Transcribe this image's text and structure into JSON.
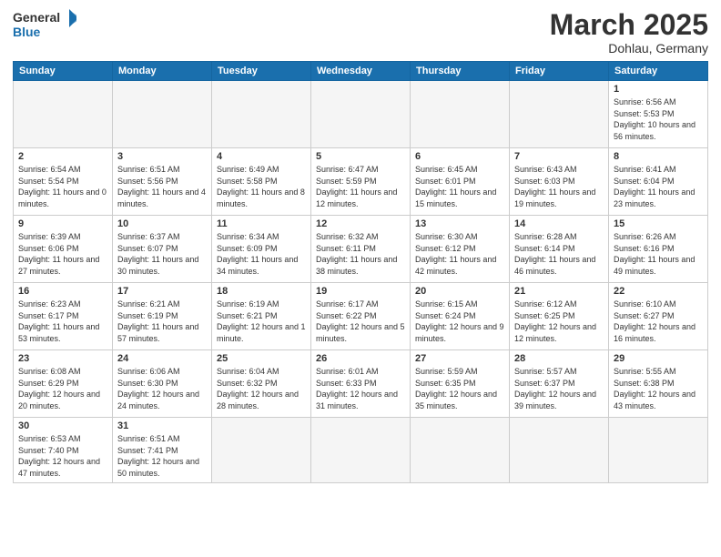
{
  "header": {
    "logo_general": "General",
    "logo_blue": "Blue",
    "month": "March 2025",
    "location": "Dohlau, Germany"
  },
  "days_of_week": [
    "Sunday",
    "Monday",
    "Tuesday",
    "Wednesday",
    "Thursday",
    "Friday",
    "Saturday"
  ],
  "weeks": [
    [
      {
        "num": "",
        "info": ""
      },
      {
        "num": "",
        "info": ""
      },
      {
        "num": "",
        "info": ""
      },
      {
        "num": "",
        "info": ""
      },
      {
        "num": "",
        "info": ""
      },
      {
        "num": "",
        "info": ""
      },
      {
        "num": "1",
        "info": "Sunrise: 6:56 AM\nSunset: 5:53 PM\nDaylight: 10 hours and 56 minutes."
      }
    ],
    [
      {
        "num": "2",
        "info": "Sunrise: 6:54 AM\nSunset: 5:54 PM\nDaylight: 11 hours and 0 minutes."
      },
      {
        "num": "3",
        "info": "Sunrise: 6:51 AM\nSunset: 5:56 PM\nDaylight: 11 hours and 4 minutes."
      },
      {
        "num": "4",
        "info": "Sunrise: 6:49 AM\nSunset: 5:58 PM\nDaylight: 11 hours and 8 minutes."
      },
      {
        "num": "5",
        "info": "Sunrise: 6:47 AM\nSunset: 5:59 PM\nDaylight: 11 hours and 12 minutes."
      },
      {
        "num": "6",
        "info": "Sunrise: 6:45 AM\nSunset: 6:01 PM\nDaylight: 11 hours and 15 minutes."
      },
      {
        "num": "7",
        "info": "Sunrise: 6:43 AM\nSunset: 6:03 PM\nDaylight: 11 hours and 19 minutes."
      },
      {
        "num": "8",
        "info": "Sunrise: 6:41 AM\nSunset: 6:04 PM\nDaylight: 11 hours and 23 minutes."
      }
    ],
    [
      {
        "num": "9",
        "info": "Sunrise: 6:39 AM\nSunset: 6:06 PM\nDaylight: 11 hours and 27 minutes."
      },
      {
        "num": "10",
        "info": "Sunrise: 6:37 AM\nSunset: 6:07 PM\nDaylight: 11 hours and 30 minutes."
      },
      {
        "num": "11",
        "info": "Sunrise: 6:34 AM\nSunset: 6:09 PM\nDaylight: 11 hours and 34 minutes."
      },
      {
        "num": "12",
        "info": "Sunrise: 6:32 AM\nSunset: 6:11 PM\nDaylight: 11 hours and 38 minutes."
      },
      {
        "num": "13",
        "info": "Sunrise: 6:30 AM\nSunset: 6:12 PM\nDaylight: 11 hours and 42 minutes."
      },
      {
        "num": "14",
        "info": "Sunrise: 6:28 AM\nSunset: 6:14 PM\nDaylight: 11 hours and 46 minutes."
      },
      {
        "num": "15",
        "info": "Sunrise: 6:26 AM\nSunset: 6:16 PM\nDaylight: 11 hours and 49 minutes."
      }
    ],
    [
      {
        "num": "16",
        "info": "Sunrise: 6:23 AM\nSunset: 6:17 PM\nDaylight: 11 hours and 53 minutes."
      },
      {
        "num": "17",
        "info": "Sunrise: 6:21 AM\nSunset: 6:19 PM\nDaylight: 11 hours and 57 minutes."
      },
      {
        "num": "18",
        "info": "Sunrise: 6:19 AM\nSunset: 6:21 PM\nDaylight: 12 hours and 1 minute."
      },
      {
        "num": "19",
        "info": "Sunrise: 6:17 AM\nSunset: 6:22 PM\nDaylight: 12 hours and 5 minutes."
      },
      {
        "num": "20",
        "info": "Sunrise: 6:15 AM\nSunset: 6:24 PM\nDaylight: 12 hours and 9 minutes."
      },
      {
        "num": "21",
        "info": "Sunrise: 6:12 AM\nSunset: 6:25 PM\nDaylight: 12 hours and 12 minutes."
      },
      {
        "num": "22",
        "info": "Sunrise: 6:10 AM\nSunset: 6:27 PM\nDaylight: 12 hours and 16 minutes."
      }
    ],
    [
      {
        "num": "23",
        "info": "Sunrise: 6:08 AM\nSunset: 6:29 PM\nDaylight: 12 hours and 20 minutes."
      },
      {
        "num": "24",
        "info": "Sunrise: 6:06 AM\nSunset: 6:30 PM\nDaylight: 12 hours and 24 minutes."
      },
      {
        "num": "25",
        "info": "Sunrise: 6:04 AM\nSunset: 6:32 PM\nDaylight: 12 hours and 28 minutes."
      },
      {
        "num": "26",
        "info": "Sunrise: 6:01 AM\nSunset: 6:33 PM\nDaylight: 12 hours and 31 minutes."
      },
      {
        "num": "27",
        "info": "Sunrise: 5:59 AM\nSunset: 6:35 PM\nDaylight: 12 hours and 35 minutes."
      },
      {
        "num": "28",
        "info": "Sunrise: 5:57 AM\nSunset: 6:37 PM\nDaylight: 12 hours and 39 minutes."
      },
      {
        "num": "29",
        "info": "Sunrise: 5:55 AM\nSunset: 6:38 PM\nDaylight: 12 hours and 43 minutes."
      }
    ],
    [
      {
        "num": "30",
        "info": "Sunrise: 6:53 AM\nSunset: 7:40 PM\nDaylight: 12 hours and 47 minutes."
      },
      {
        "num": "31",
        "info": "Sunrise: 6:51 AM\nSunset: 7:41 PM\nDaylight: 12 hours and 50 minutes."
      },
      {
        "num": "",
        "info": ""
      },
      {
        "num": "",
        "info": ""
      },
      {
        "num": "",
        "info": ""
      },
      {
        "num": "",
        "info": ""
      },
      {
        "num": "",
        "info": ""
      }
    ]
  ]
}
